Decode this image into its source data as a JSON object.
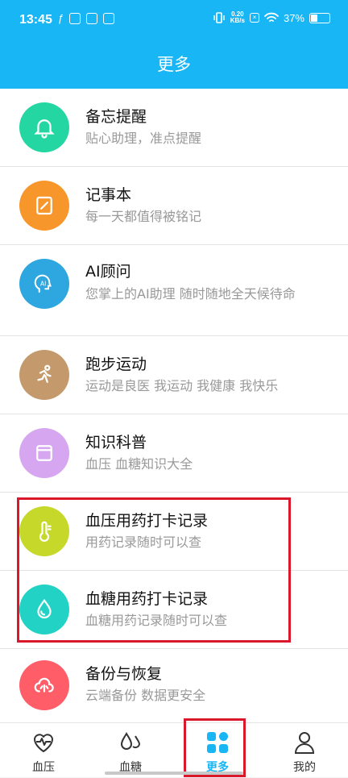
{
  "status_bar": {
    "time": "13:45",
    "net_speed": "0.20",
    "net_unit": "KB/s",
    "battery": "37%"
  },
  "header": {
    "title": "更多"
  },
  "items": [
    {
      "title": "备忘提醒",
      "subtitle": "贴心助理，准点提醒",
      "icon": "bell-icon",
      "color": "#24d6a2"
    },
    {
      "title": "记事本",
      "subtitle": "每一天都值得被铭记",
      "icon": "notepad-icon",
      "color": "#f7962a"
    },
    {
      "title": "AI顾问",
      "subtitle": "您掌上的AI助理 随时随地全天候待命",
      "icon": "ai-head-icon",
      "color": "#2ea7e0"
    },
    {
      "title": "跑步运动",
      "subtitle": "运动是良医 我运动 我健康 我快乐",
      "icon": "runner-icon",
      "color": "#c49a6c"
    },
    {
      "title": "知识科普",
      "subtitle": "血压 血糖知识大全",
      "icon": "book-icon",
      "color": "#d7a6f0"
    },
    {
      "title": "血压用药打卡记录",
      "subtitle": "用药记录随时可以查",
      "icon": "thermometer-icon",
      "color": "#c6d82a"
    },
    {
      "title": "血糖用药打卡记录",
      "subtitle": "血糖用药记录随时可以查",
      "icon": "drop-icon",
      "color": "#22d3c5"
    },
    {
      "title": "备份与恢复",
      "subtitle": "云端备份 数据更安全",
      "icon": "cloud-icon",
      "color": "#ff5d68"
    }
  ],
  "tabs": [
    {
      "label": "血压",
      "icon": "heart-pulse-icon"
    },
    {
      "label": "血糖",
      "icon": "drops-icon"
    },
    {
      "label": "更多",
      "icon": "grid-icon",
      "active": true
    },
    {
      "label": "我的",
      "icon": "person-icon"
    }
  ]
}
